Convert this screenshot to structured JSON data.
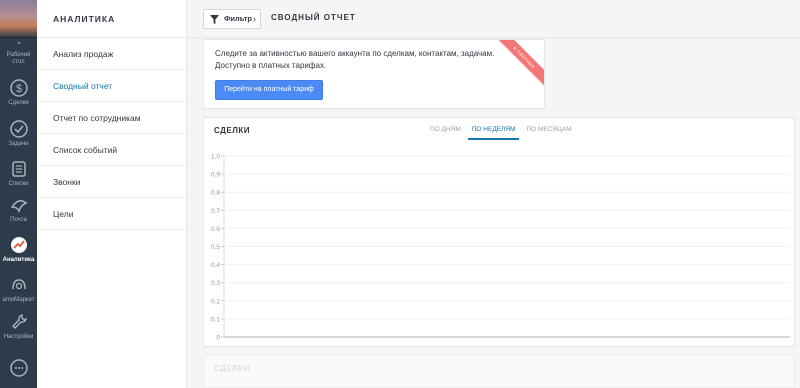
{
  "nav": {
    "items": [
      {
        "label": "Рабочий стол",
        "line1": "Рабочий",
        "line2": "стол",
        "icon": "dashboard-icon"
      },
      {
        "label": "Сделки",
        "icon": "dollar-icon"
      },
      {
        "label": "Задачи",
        "icon": "check-icon"
      },
      {
        "label": "Списки",
        "icon": "list-icon"
      },
      {
        "label": "Почта",
        "icon": "mail-icon"
      },
      {
        "label": "Аналитика",
        "icon": "analytics-icon",
        "active": true
      },
      {
        "label": "amoМаркет",
        "icon": "market-icon"
      },
      {
        "label": "Настройки",
        "icon": "wrench-icon"
      },
      {
        "label": "",
        "icon": "chat-icon"
      }
    ]
  },
  "submenu": {
    "title": "АНАЛИТИКА",
    "items": [
      {
        "label": "Анализ продаж"
      },
      {
        "label": "Сводный отчет",
        "active": true
      },
      {
        "label": "Отчет по сотрудникам"
      },
      {
        "label": "Список событий"
      },
      {
        "label": "Звонки"
      },
      {
        "label": "Цели"
      }
    ]
  },
  "topbar": {
    "filter_label": "Фильтр",
    "page_title": "СВОДНЫЙ ОТЧЕТ"
  },
  "promo": {
    "text": "Следите за активностью вашего аккаунта по сделкам, контактам, задачам. Доступно в платных тарифах.",
    "button": "Перейти на платный тариф",
    "ribbon": "В ПЛАТНЫХ"
  },
  "chart_card": {
    "title": "СДЕЛКИ",
    "tabs": [
      {
        "label": "ПО ДНЯМ"
      },
      {
        "label": "ПО НЕДЕЛЯМ",
        "active": true
      },
      {
        "label": "ПО МЕСЯЦАМ"
      }
    ]
  },
  "chart_data": {
    "type": "line",
    "title": "",
    "xlabel": "",
    "ylabel": "",
    "ylim": [
      0,
      1
    ],
    "yticks": [
      "1.0",
      "0.9",
      "0.8",
      "0.7",
      "0.6",
      "0.5",
      "0.4",
      "0.3",
      "0.2",
      "0.1",
      "0"
    ],
    "series": [],
    "grid": true
  },
  "second_card": {
    "title": "СДЕЛКИ"
  },
  "colors": {
    "nav_bg": "#2d3b4a",
    "accent": "#1375ab",
    "button": "#4c8bf5",
    "ribbon": "#f37575"
  }
}
